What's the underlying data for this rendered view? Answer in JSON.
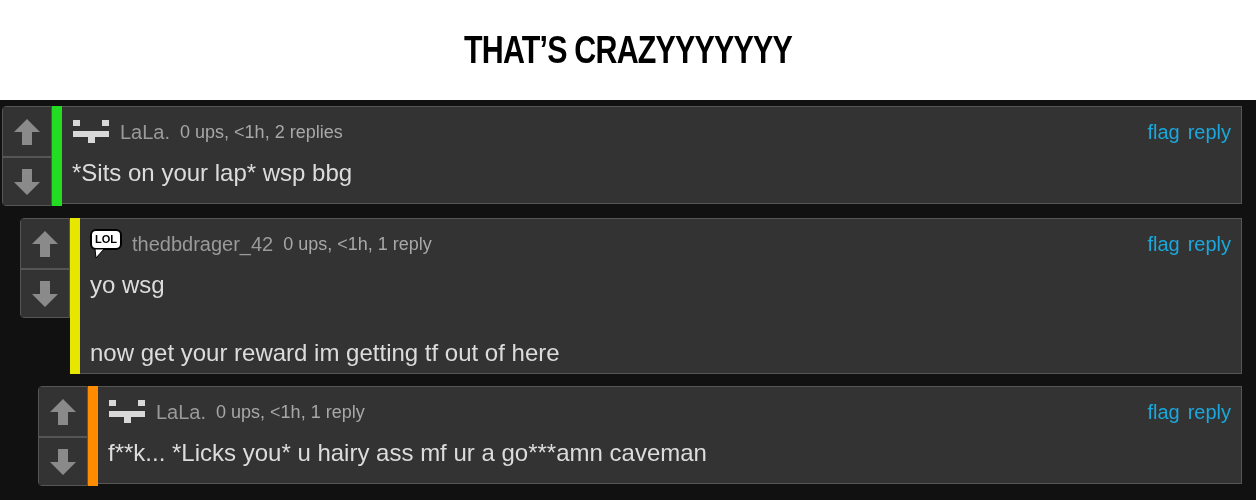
{
  "caption": "THAT’S CRAZYYYYYYY",
  "comments": [
    {
      "avatar": {
        "kind": "pixel"
      },
      "username": "LaLa.",
      "meta": "0 ups, <1h, 2 replies",
      "color": "#22dd22",
      "actions": [
        "flag",
        "reply"
      ],
      "lines": [
        "*Sits on your lap* wsp bbg"
      ],
      "children": [
        {
          "avatar": {
            "kind": "lol",
            "text": "LOL"
          },
          "username": "thedbdrager_42",
          "meta": "0 ups, <1h, 1 reply",
          "color": "#e6e600",
          "actions": [
            "flag",
            "reply"
          ],
          "lines": [
            "yo wsg",
            "now get your reward im getting tf out of here"
          ],
          "children": [
            {
              "avatar": {
                "kind": "pixel"
              },
              "username": "LaLa.",
              "meta": "0 ups, <1h, 1 reply",
              "color": "#ff8c00",
              "actions": [
                "flag",
                "reply"
              ],
              "lines": [
                "f**k... *Licks you* u hairy ass mf ur a go***amn caveman"
              ]
            }
          ]
        }
      ]
    }
  ]
}
